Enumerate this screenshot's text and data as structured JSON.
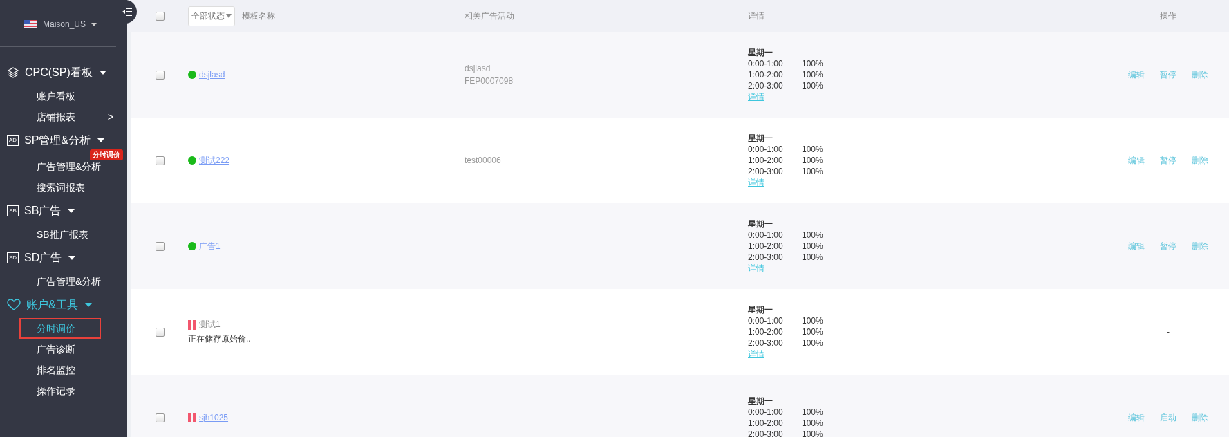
{
  "sidebar": {
    "account": "Maison_US",
    "groups": [
      {
        "label": "CPC(SP)看板",
        "kind": "layers",
        "active": false,
        "items": [
          {
            "label": "账户看板",
            "selected": false,
            "highlighted": false
          },
          {
            "label": "店铺报表",
            "arrow": ">",
            "selected": false,
            "highlighted": false
          }
        ]
      },
      {
        "label": "SP管理&分析",
        "kind": "badge",
        "icon_text": "AD",
        "active": false,
        "items": [
          {
            "label": "广告管理&分析",
            "badge": "分时调价",
            "selected": false,
            "highlighted": false
          },
          {
            "label": "搜索词报表",
            "selected": false,
            "highlighted": false
          }
        ]
      },
      {
        "label": "SB广告",
        "kind": "badge",
        "icon_text": "SB",
        "active": false,
        "items": [
          {
            "label": "SB推广报表",
            "selected": false,
            "highlighted": false
          }
        ]
      },
      {
        "label": "SD广告",
        "kind": "badge",
        "icon_text": "SD",
        "active": false,
        "items": [
          {
            "label": "广告管理&分析",
            "selected": false,
            "highlighted": false
          }
        ]
      },
      {
        "label": "账户&工具",
        "kind": "heart",
        "active": true,
        "items": [
          {
            "label": "分时调价",
            "selected": true,
            "highlighted": true
          },
          {
            "label": "广告诊断",
            "selected": false,
            "highlighted": false
          },
          {
            "label": "排名监控",
            "selected": false,
            "highlighted": false
          },
          {
            "label": "操作记录",
            "selected": false,
            "highlighted": false
          }
        ]
      }
    ]
  },
  "table": {
    "all_checked": false,
    "status_filter": "全部状态",
    "columns": [
      "模板名称",
      "相关广告活动",
      "详情",
      "操作"
    ],
    "rows": [
      {
        "checked": false,
        "kind": "running",
        "name": "dsjlasd",
        "name_link": true,
        "campaigns": [
          "dsjlasd",
          "FEP0007098"
        ],
        "schedule": {
          "day": "星期一",
          "slots": [
            {
              "time": "0:00-1:00",
              "pct": "100%"
            },
            {
              "time": "1:00-2:00",
              "pct": "100%"
            },
            {
              "time": "2:00-3:00",
              "pct": "100%"
            }
          ],
          "link": "详情"
        },
        "actions": [
          "编辑",
          "暂停",
          "删除"
        ]
      },
      {
        "checked": false,
        "kind": "running",
        "name": "测试222",
        "name_link": true,
        "campaigns": [
          "test00006"
        ],
        "schedule": {
          "day": "星期一",
          "slots": [
            {
              "time": "0:00-1:00",
              "pct": "100%"
            },
            {
              "time": "1:00-2:00",
              "pct": "100%"
            },
            {
              "time": "2:00-3:00",
              "pct": "100%"
            }
          ],
          "link": "详情"
        },
        "actions": [
          "编辑",
          "暂停",
          "删除"
        ]
      },
      {
        "checked": false,
        "kind": "running",
        "name": "广告1",
        "name_link": true,
        "campaigns": [],
        "schedule": {
          "day": "星期一",
          "slots": [
            {
              "time": "0:00-1:00",
              "pct": "100%"
            },
            {
              "time": "1:00-2:00",
              "pct": "100%"
            },
            {
              "time": "2:00-3:00",
              "pct": "100%"
            }
          ],
          "link": "详情"
        },
        "actions": [
          "编辑",
          "暂停",
          "删除"
        ]
      },
      {
        "checked": false,
        "kind": "paused",
        "name": "测试1",
        "name_link": false,
        "note": "正在储存原始价..",
        "campaigns": [],
        "schedule": {
          "day": "星期一",
          "slots": [
            {
              "time": "0:00-1:00",
              "pct": "100%"
            },
            {
              "time": "1:00-2:00",
              "pct": "100%"
            },
            {
              "time": "2:00-3:00",
              "pct": "100%"
            }
          ],
          "link": "详情"
        },
        "actions": [],
        "no_actions": "-"
      },
      {
        "checked": false,
        "kind": "paused",
        "name": "sjh1025",
        "name_link": true,
        "campaigns": [],
        "schedule": {
          "day": "星期一",
          "slots": [
            {
              "time": "0:00-1:00",
              "pct": "100%"
            },
            {
              "time": "1:00-2:00",
              "pct": "100%"
            },
            {
              "time": "2:00-3:00",
              "pct": "100%"
            }
          ]
        },
        "actions": [
          "编辑",
          "启动",
          "删除"
        ]
      }
    ]
  }
}
